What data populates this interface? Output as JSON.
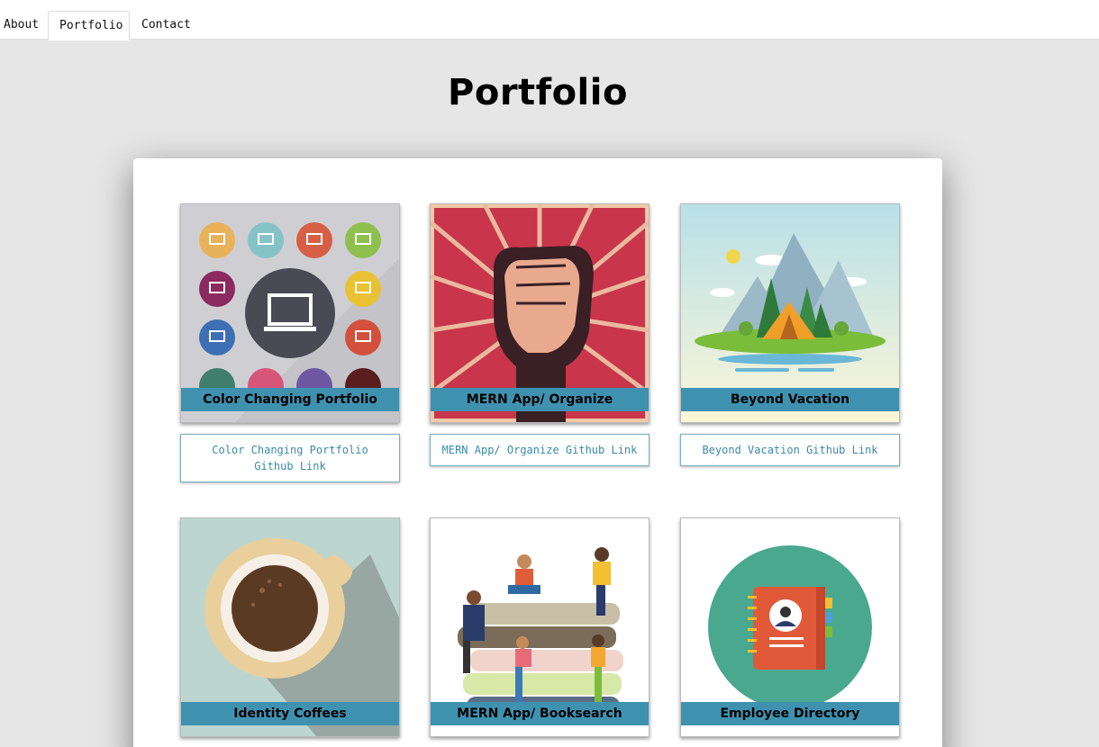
{
  "nav": {
    "tabs": [
      {
        "label": "About"
      },
      {
        "label": "Portfolio"
      },
      {
        "label": "Contact"
      }
    ],
    "active": "Portfolio"
  },
  "page": {
    "title": "Portfolio"
  },
  "colors": {
    "caption_bar": "#3e92b0",
    "link_text": "#3a8aa8",
    "page_bg": "#e6e6e6"
  },
  "projects": [
    {
      "title": "Color Changing Portfolio",
      "link_label": "Color Changing Portfolio Github Link",
      "image_icon": "laptop-icons-grid"
    },
    {
      "title": "MERN App/ Organize",
      "link_label": "MERN App/ Organize Github Link",
      "image_icon": "raised-fist-poster"
    },
    {
      "title": "Beyond Vacation",
      "link_label": "Beyond Vacation Github Link",
      "image_icon": "camping-mountains"
    },
    {
      "title": "Identity Coffees",
      "link_label": "",
      "image_icon": "coffee-cup"
    },
    {
      "title": "MERN App/ Booksearch",
      "link_label": "",
      "image_icon": "people-reading-books"
    },
    {
      "title": "Employee Directory",
      "link_label": "",
      "image_icon": "address-book"
    }
  ]
}
